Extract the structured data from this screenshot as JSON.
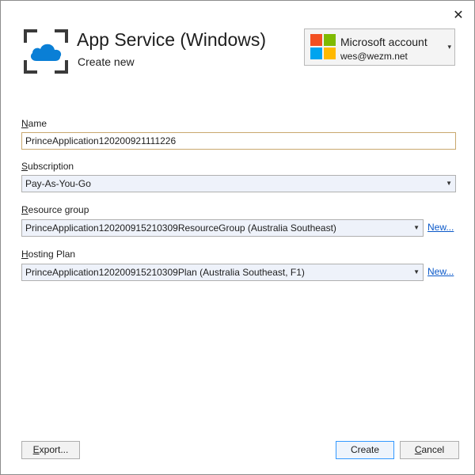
{
  "header": {
    "title": "App Service (Windows)",
    "subtitle": "Create new",
    "close_glyph": "✕"
  },
  "account": {
    "name": "Microsoft account",
    "email": "wes@wezm.net",
    "caret": "▾"
  },
  "form": {
    "name": {
      "label_key": "N",
      "label_rest": "ame",
      "value": "PrinceApplication120200921111226"
    },
    "subscription": {
      "label_key": "S",
      "label_rest": "ubscription",
      "value": "Pay-As-You-Go"
    },
    "resource_group": {
      "label_key": "R",
      "label_rest": "esource group",
      "value": "PrinceApplication120200915210309ResourceGroup (Australia Southeast)",
      "new_link": "New..."
    },
    "hosting_plan": {
      "label_key": "H",
      "label_rest": "osting Plan",
      "value": "PrinceApplication120200915210309Plan (Australia Southeast, F1)",
      "new_link": "New..."
    },
    "caret": "▼"
  },
  "buttons": {
    "export_key": "E",
    "export_rest": "xport...",
    "create": "Create",
    "cancel_key": "C",
    "cancel_rest": "ancel"
  },
  "colors": {
    "cloud": "#0a7fd6",
    "frame": "#3a3a3a",
    "ms_red": "#f25022",
    "ms_green": "#7fba00",
    "ms_blue": "#00a4ef",
    "ms_yellow": "#ffb900"
  }
}
